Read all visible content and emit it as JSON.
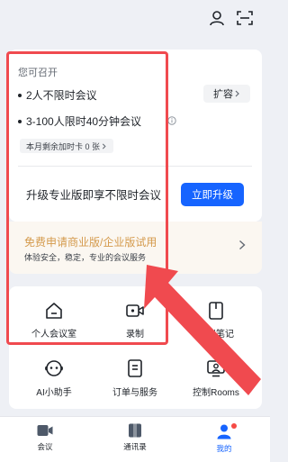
{
  "header": {
    "user_icon": "user-icon",
    "scan_icon": "scan-icon"
  },
  "meeting_card": {
    "title": "您可召开",
    "lines": [
      {
        "text": "2人不限时会议"
      },
      {
        "text": "3-100人限时40分钟会议"
      }
    ],
    "expand_label": "扩容",
    "remaining_text": "本月剩余加时卡 0 张",
    "upgrade_text": "升级专业版即享不限时会议",
    "upgrade_button": "立即升级"
  },
  "promo": {
    "title": "免费申请商业版/企业版试用",
    "subtitle": "体验安全，稳定，专业的会议服务"
  },
  "grid": {
    "items": [
      {
        "label": "个人会议室",
        "icon": "home-icon"
      },
      {
        "label": "录制",
        "icon": "video-record-icon"
      },
      {
        "label": "会议笔记",
        "icon": "notes-icon"
      },
      {
        "label": "AI小助手",
        "icon": "ai-assistant-icon"
      },
      {
        "label": "订单与服务",
        "icon": "order-icon"
      },
      {
        "label": "控制Rooms",
        "icon": "rooms-icon"
      }
    ]
  },
  "tabbar": {
    "tabs": [
      {
        "label": "会议",
        "icon": "meeting-camera-icon"
      },
      {
        "label": "通讯录",
        "icon": "contacts-icon"
      },
      {
        "label": "我的",
        "icon": "profile-icon",
        "active": true
      }
    ]
  },
  "colors": {
    "accent": "#1664ff",
    "promo_text": "#d49a4c",
    "annotation_red": "#f04a4f",
    "background": "#eef0f5"
  }
}
